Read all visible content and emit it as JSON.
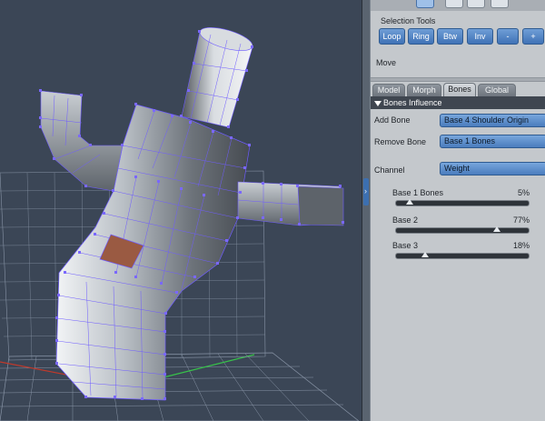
{
  "viewport": {
    "label": "3D viewport"
  },
  "panel": {
    "top_icons": [
      "select-icon",
      "joint-icon",
      "node-icon",
      "fill-icon"
    ],
    "selection_tools": {
      "title": "Selection Tools",
      "buttons": [
        "Loop",
        "Ring",
        "Btw",
        "Inv",
        "-",
        "+"
      ]
    },
    "mode": "Move",
    "tabs": [
      {
        "label": "Model",
        "active": false
      },
      {
        "label": "Morph",
        "active": false
      },
      {
        "label": "Bones",
        "active": true
      },
      {
        "label": "Global",
        "active": false
      }
    ],
    "section": "Bones Influence",
    "add_bone": {
      "label": "Add Bone",
      "value": "Base 4 Shoulder Origin"
    },
    "remove_bone": {
      "label": "Remove Bone",
      "value": "Base 1 Bones"
    },
    "channel": {
      "label": "Channel",
      "value": "Weight"
    },
    "sliders": [
      {
        "name": "Base 1 Bones",
        "value": "5%",
        "fraction": 0.05
      },
      {
        "name": "Base 2",
        "value": "77%",
        "fraction": 0.77
      },
      {
        "name": "Base 3",
        "value": "18%",
        "fraction": 0.18
      }
    ]
  },
  "colors": {
    "viewport_bg": "#3b4656",
    "grid": "#8894a6",
    "mesh_light": "#eef0f2",
    "mesh_mid": "#9aa1a8",
    "mesh_dark": "#4c5258",
    "selected_face": "#9a5a42",
    "vertex": "#6f5cff",
    "accent": "#3f72b6"
  }
}
